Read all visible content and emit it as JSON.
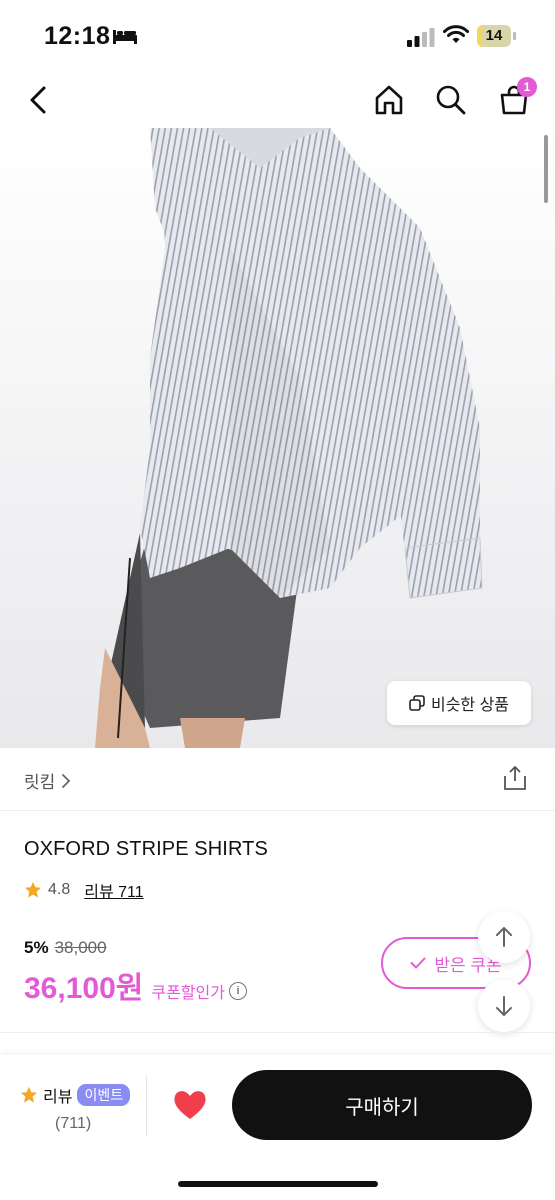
{
  "status_bar": {
    "time": "12:18",
    "battery": "14",
    "battery_level": 0.14,
    "icons": [
      "bed-icon",
      "signal-icon",
      "wifi-icon",
      "battery-icon"
    ]
  },
  "nav": {
    "icons": [
      "back-icon",
      "home-icon",
      "search-icon",
      "shopping-bag-icon"
    ],
    "cart_count": "1"
  },
  "hero": {
    "similar_label": "비슷한 상품"
  },
  "brand": {
    "name": "릿킴"
  },
  "product": {
    "title": "OXFORD STRIPE SHIRTS",
    "rating": "4.8",
    "review_label": "리뷰 711",
    "discount_rate": "5%",
    "original_price": "38,000",
    "price": "36,100원",
    "coupon_note": "쿠폰할인가",
    "coupon_button": "받은 쿠폰"
  },
  "bottom_bar": {
    "review_label": "리뷰",
    "event_badge": "이벤트",
    "review_count": "(711)",
    "buy_label": "구매하기"
  },
  "colors": {
    "accent": "#e25ad6",
    "event": "#8b8cf3",
    "star": "#f5a623",
    "heart": "#f03e4d",
    "buy_button": "#111111"
  }
}
